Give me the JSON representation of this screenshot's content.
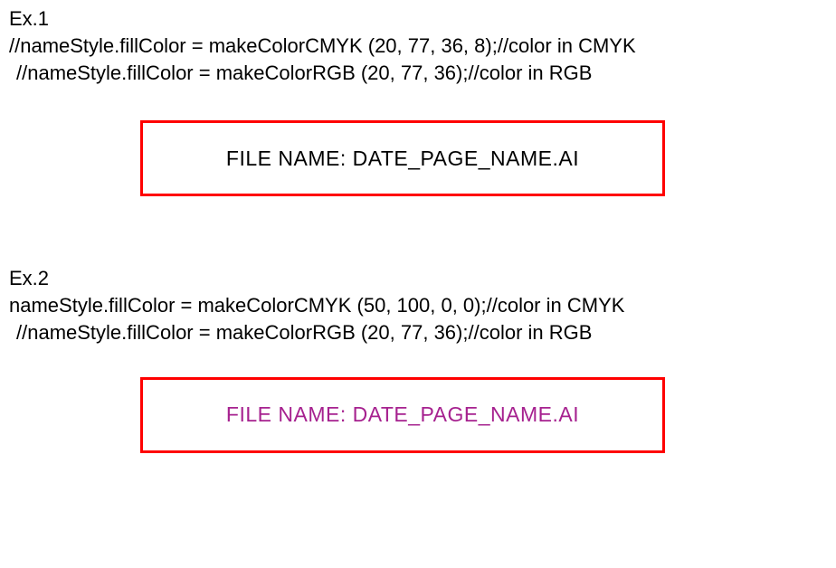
{
  "ex1": {
    "label": "Ex.1",
    "line1": "//nameStyle.fillColor = makeColorCMYK (20, 77, 36, 8);//color in CMYK",
    "line2": "//nameStyle.fillColor = makeColorRGB (20, 77, 36);//color in RGB",
    "output": "FILE NAME: DATE_PAGE_NAME.AI"
  },
  "ex2": {
    "label": "Ex.2",
    "line1": "nameStyle.fillColor = makeColorCMYK (50, 100, 0, 0);//color in CMYK",
    "line2": "//nameStyle.fillColor = makeColorRGB (20, 77, 36);//color in RGB",
    "output": "FILE NAME: DATE_PAGE_NAME.AI"
  },
  "colors": {
    "box_border": "#ff0000",
    "ex1_text": "#000000",
    "ex2_text": "#a6218f"
  }
}
